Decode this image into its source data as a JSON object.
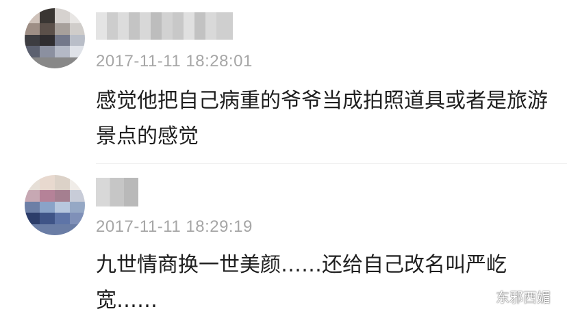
{
  "comments": [
    {
      "avatar_icon": "user-avatar-blurred",
      "username_icon": "username-blurred",
      "timestamp": "2017-11-11 18:28:01",
      "text": "感觉他把自己病重的爷爷当成拍照道具或者是旅游景点的感觉"
    },
    {
      "avatar_icon": "user-avatar-blurred",
      "username_icon": "username-blurred",
      "timestamp": "2017-11-11 18:29:19",
      "text": "九世情商换一世美颜……还给自己改名叫严屹宽……"
    }
  ],
  "watermark": {
    "icon": "wechat-icon",
    "text": "东邪西媚"
  },
  "colors": {
    "background": "#ffffff",
    "timestamp": "#a6a6a6",
    "text": "#1f1f1f"
  }
}
